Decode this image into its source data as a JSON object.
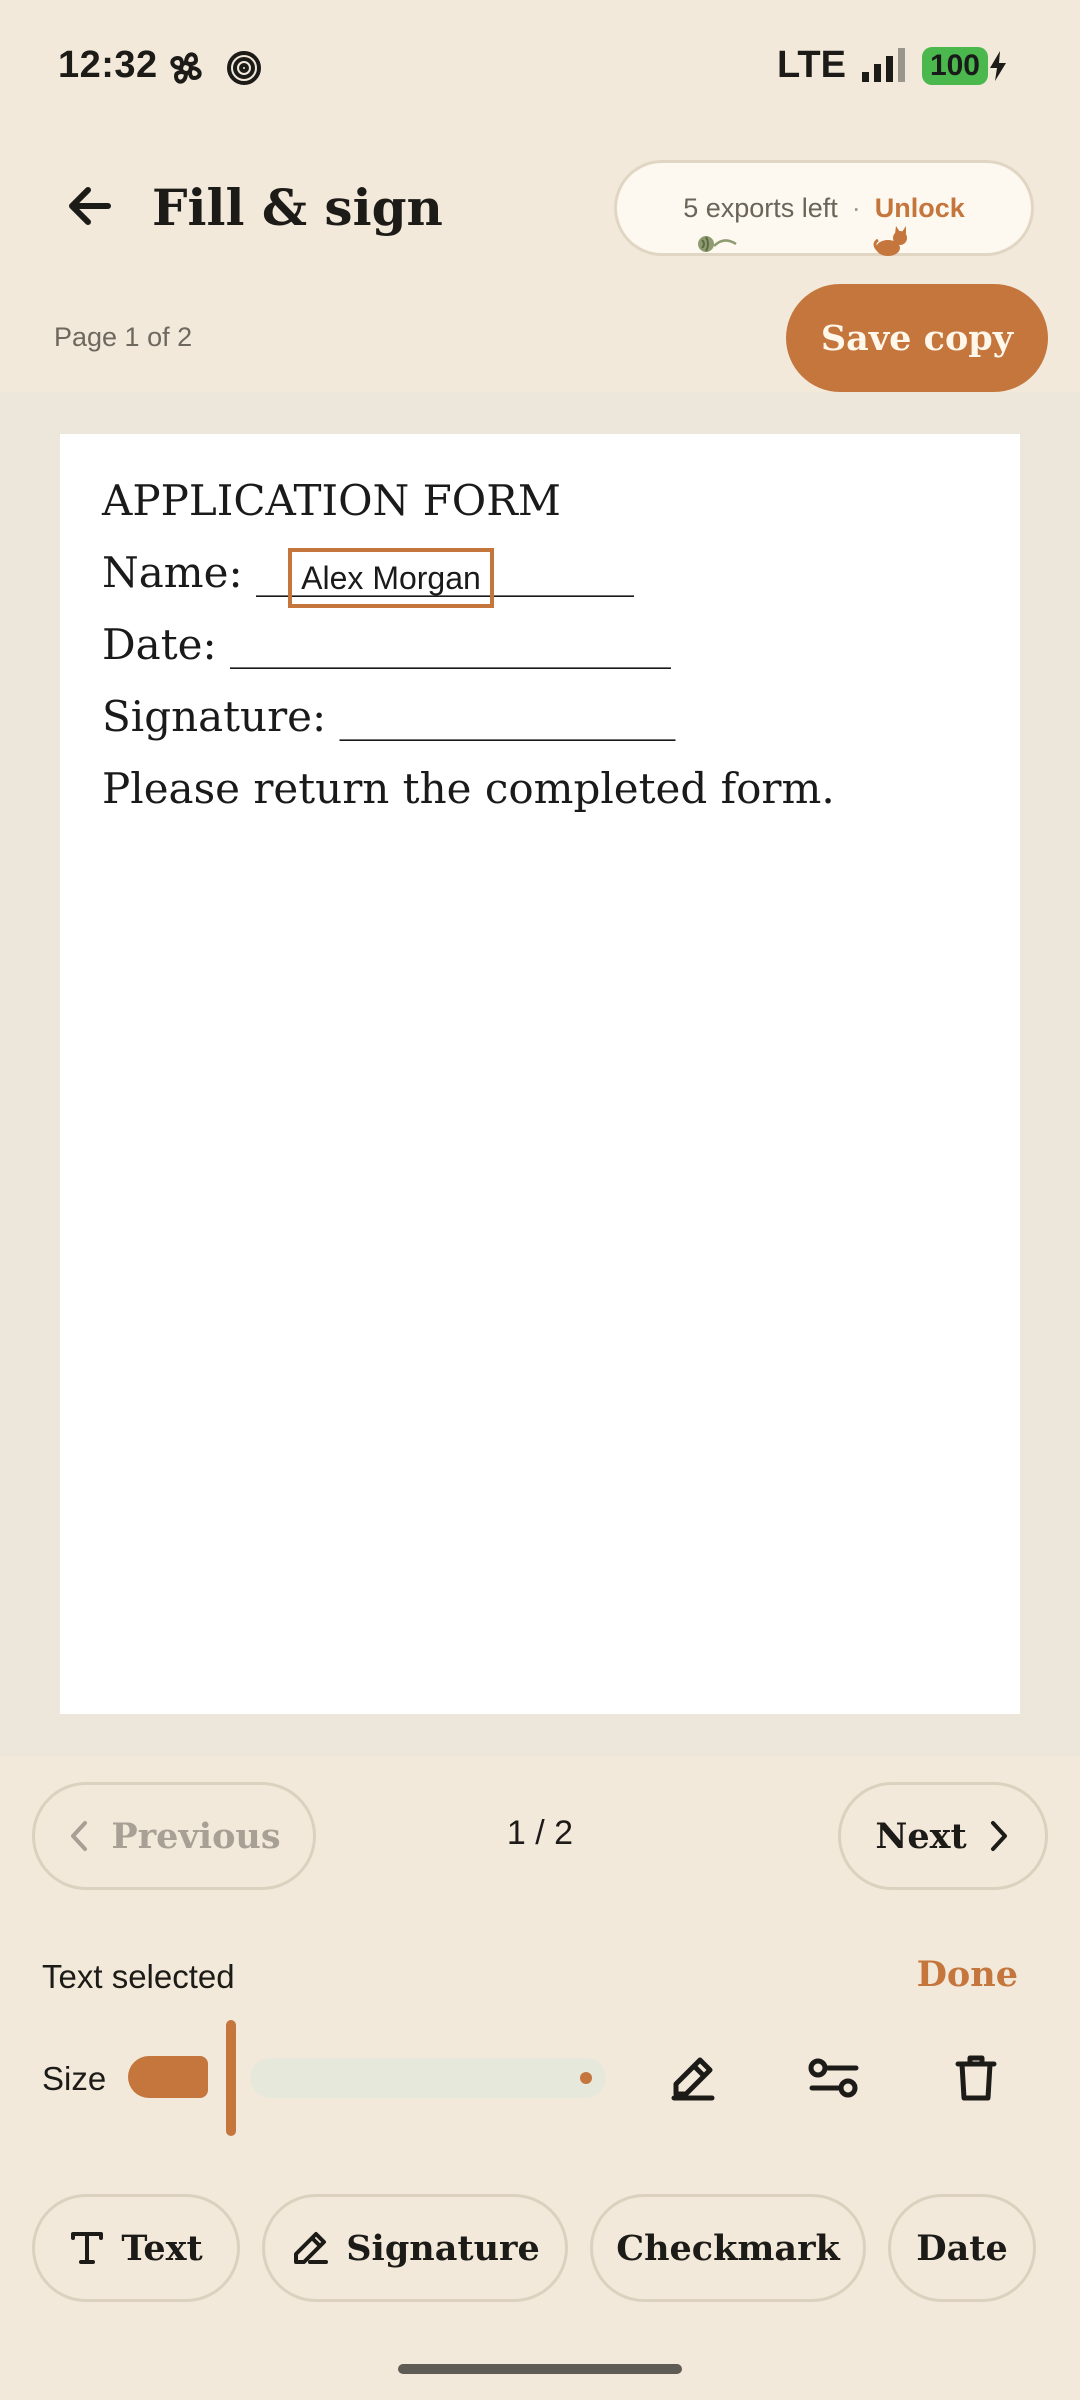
{
  "status_bar": {
    "time": "12:32",
    "network": "LTE",
    "battery": "100"
  },
  "header": {
    "title": "Fill & sign",
    "exports_left": "5 exports left",
    "separator": "·",
    "unlock": "Unlock"
  },
  "toolbar": {
    "page_indicator": "Page 1 of 2",
    "save_copy": "Save copy"
  },
  "document": {
    "title": "APPLICATION FORM",
    "name_line": "Name: __________________",
    "date_line": "Date: _____________________",
    "signature_line": "Signature: ________________",
    "note": "Please return the completed form.",
    "filled_name": "Alex Morgan"
  },
  "pagination": {
    "previous": "Previous",
    "next": "Next",
    "count": "1 / 2"
  },
  "selection": {
    "label": "Text selected",
    "done": "Done",
    "size_label": "Size",
    "size_level": 0.05
  },
  "tools": {
    "text": "Text",
    "signature": "Signature",
    "checkmark": "Checkmark",
    "date": "Date"
  },
  "colors": {
    "accent": "#c4763d",
    "background": "#f2e9da",
    "battery": "#4ab84d"
  }
}
